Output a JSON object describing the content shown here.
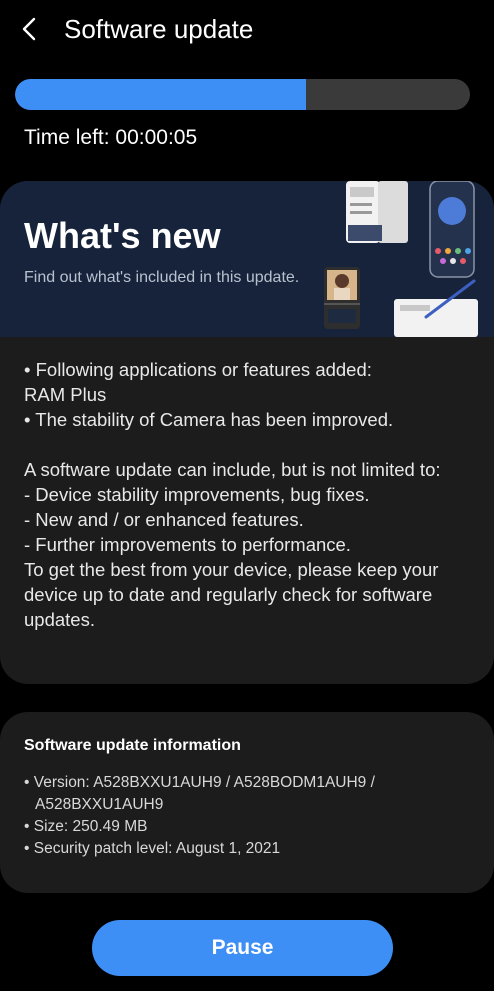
{
  "header": {
    "title": "Software update",
    "back_icon": "chevron-left-icon"
  },
  "progress": {
    "fraction": 0.64,
    "time_left": "Time left: 00:00:05"
  },
  "whats_new": {
    "title": "What's new",
    "subtitle": "Find out what's included in this update."
  },
  "notes": {
    "added_line1": "• Following applications or features added:",
    "added_line2": "RAM Plus",
    "camera": "• The stability of Camera has been improved.",
    "intro": "A software update can include, but is not limited to:",
    "item1": " - Device stability improvements, bug fixes.",
    "item2": " - New and / or enhanced features.",
    "item3": " - Further improvements to performance.",
    "outro": "To get the best from your device, please keep your device up to date and regularly check for software updates."
  },
  "info": {
    "title": "Software update information",
    "version_line1": "• Version: A528BXXU1AUH9 / A528BODM1AUH9 /",
    "version_line2": "A528BXXU1AUH9",
    "size": "• Size: 250.49 MB",
    "security": "• Security patch level: August 1, 2021"
  },
  "actions": {
    "pause_label": "Pause"
  },
  "colors": {
    "accent": "#3d8ff5",
    "card": "#1c1c1c",
    "banner": "#16233a"
  }
}
